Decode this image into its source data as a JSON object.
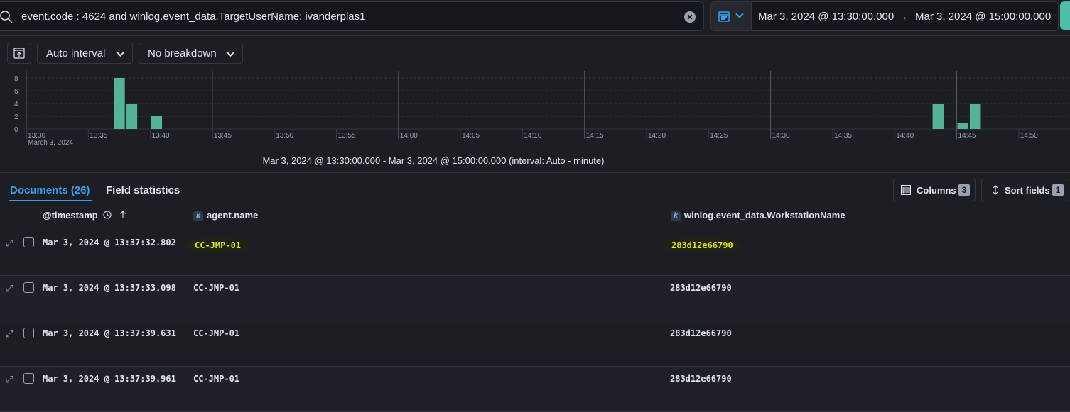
{
  "search": {
    "query": "event.code : 4624 and winlog.event_data.TargetUserName: ivanderplas1",
    "date_start": "Mar 3, 2024 @ 13:30:00.000",
    "date_end": "Mar 3, 2024 @ 15:00:00.000"
  },
  "histogram": {
    "interval_label": "Auto interval",
    "breakdown_label": "No breakdown",
    "caption": "Mar 3, 2024 @ 13:30:00.000 - Mar 3, 2024 @ 15:00:00.000 (interval: Auto - minute)"
  },
  "chart_data": {
    "type": "bar",
    "x_date_label": "March 3, 2024",
    "y_ticks": [
      "8",
      "6",
      "4",
      "2",
      "0"
    ],
    "x_ticks": [
      "13:30",
      "13:35",
      "13:40",
      "13:45",
      "13:50",
      "13:55",
      "14:00",
      "14:05",
      "14:10",
      "14:15",
      "14:20",
      "14:25",
      "14:30",
      "14:35",
      "14:40",
      "14:45",
      "14:50"
    ],
    "x": [
      "13:37",
      "13:38",
      "13:40",
      "14:43",
      "14:45",
      "14:46"
    ],
    "values": [
      8,
      4,
      2,
      4,
      1,
      4
    ],
    "ylim": [
      0,
      8
    ],
    "bar_color": "#54b399",
    "grid": true
  },
  "tabs": {
    "documents": "Documents (26)",
    "field_statistics": "Field statistics"
  },
  "toolbar": {
    "columns_label": "Columns",
    "columns_count": "3",
    "sort_label": "Sort fields",
    "sort_count": "1"
  },
  "table": {
    "headers": [
      "@timestamp",
      "agent.name",
      "winlog.event_data.WorkstationName"
    ],
    "field_type": "k",
    "rows": [
      {
        "timestamp": "Mar 3, 2024 @ 13:37:32.802",
        "agent": "CC-JMP-01",
        "workstation": "283d12e66790"
      },
      {
        "timestamp": "Mar 3, 2024 @ 13:37:33.098",
        "agent": "CC-JMP-01",
        "workstation": "283d12e66790"
      },
      {
        "timestamp": "Mar 3, 2024 @ 13:37:39.631",
        "agent": "CC-JMP-01",
        "workstation": "283d12e66790"
      },
      {
        "timestamp": "Mar 3, 2024 @ 13:37:39.961",
        "agent": "CC-JMP-01",
        "workstation": "283d12e66790"
      }
    ]
  }
}
